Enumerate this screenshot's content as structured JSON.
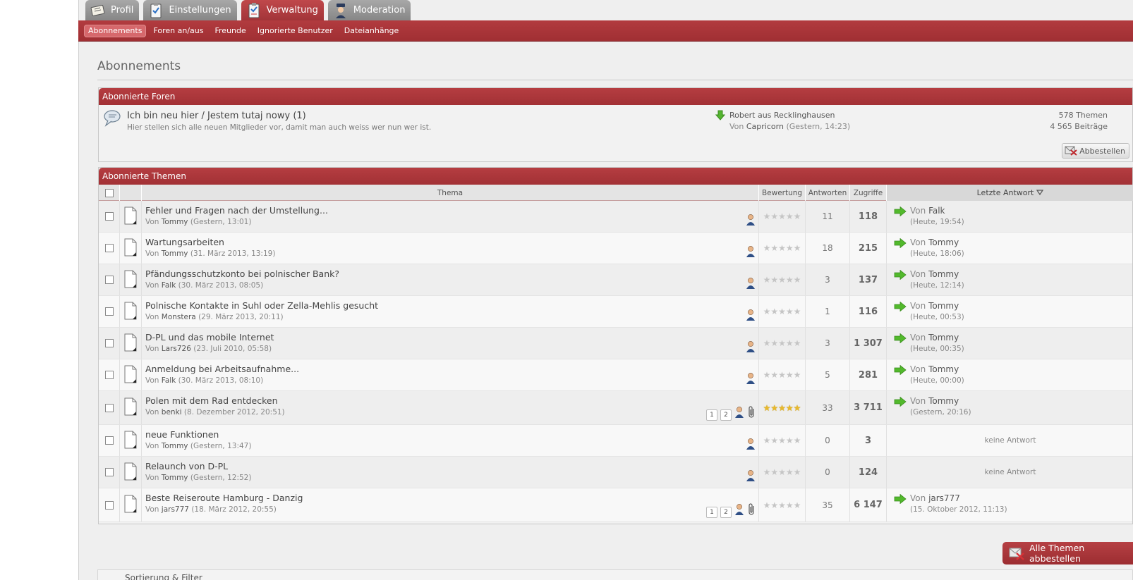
{
  "tabs": [
    {
      "label": "Profil",
      "icon": "profile-card-icon",
      "active": false
    },
    {
      "label": "Einstellungen",
      "icon": "settings-clipboard-icon",
      "active": false
    },
    {
      "label": "Verwaltung",
      "icon": "management-clipboard-icon",
      "active": true
    },
    {
      "label": "Moderation",
      "icon": "moderator-officer-icon",
      "active": false
    }
  ],
  "subnav": [
    {
      "label": "Abonnements",
      "active": true
    },
    {
      "label": "Foren an/aus",
      "active": false
    },
    {
      "label": "Freunde",
      "active": false
    },
    {
      "label": "Ignorierte Benutzer",
      "active": false
    },
    {
      "label": "Dateianhänge",
      "active": false
    }
  ],
  "page_title": "Abonnements",
  "forums_box": {
    "heading": "Abonnierte Foren",
    "forum": {
      "title": "Ich bin neu hier / Jestem tutaj nowy (1)",
      "description": "Hier stellen sich alle neuen Mitglieder vor, damit man auch weiss wer nun wer ist.",
      "last_post_title": "Robert aus Recklinghausen",
      "last_post_by_prefix": "Von",
      "last_post_author": "Capricorn",
      "last_post_time": "(Gestern, 14:23)",
      "threads": "578 Themen",
      "posts": "4 565 Beiträge"
    },
    "unsubscribe_label": "Abbestellen"
  },
  "topics_box": {
    "heading": "Abonnierte Themen",
    "columns": {
      "topic": "Thema",
      "rating": "Bewertung",
      "replies": "Antworten",
      "views": "Zugriffe",
      "last_reply": "Letzte Antwort"
    },
    "rows": [
      {
        "title": "Fehler und Fragen nach der Umstellung...",
        "by": "Von",
        "author": "Tommy",
        "date": "(Gestern, 13:01)",
        "pages": [],
        "attachment": false,
        "rating": 0,
        "replies": "11",
        "views": "118",
        "last_by": "Von",
        "last_author": "Falk",
        "last_time": "(Heute, 19:54)"
      },
      {
        "title": "Wartungsarbeiten",
        "by": "Von",
        "author": "Tommy",
        "date": "(31. März 2013, 13:19)",
        "pages": [],
        "attachment": false,
        "rating": 0,
        "replies": "18",
        "views": "215",
        "last_by": "Von",
        "last_author": "Tommy",
        "last_time": "(Heute, 18:06)"
      },
      {
        "title": "Pfändungsschutzkonto bei polnischer Bank?",
        "by": "Von",
        "author": "Falk",
        "date": "(30. März 2013, 08:05)",
        "pages": [],
        "attachment": false,
        "rating": 0,
        "replies": "3",
        "views": "137",
        "last_by": "Von",
        "last_author": "Tommy",
        "last_time": "(Heute, 12:14)"
      },
      {
        "title": "Polnische Kontakte in Suhl oder Zella-Mehlis gesucht",
        "by": "Von",
        "author": "Monstera",
        "date": "(29. März 2013, 20:11)",
        "pages": [],
        "attachment": false,
        "rating": 0,
        "replies": "1",
        "views": "116",
        "last_by": "Von",
        "last_author": "Tommy",
        "last_time": "(Heute, 00:53)"
      },
      {
        "title": "D-PL und das mobile Internet",
        "by": "Von",
        "author": "Lars726",
        "date": "(23. Juli 2010, 05:58)",
        "pages": [],
        "attachment": false,
        "rating": 0,
        "replies": "3",
        "views": "1 307",
        "last_by": "Von",
        "last_author": "Tommy",
        "last_time": "(Heute, 00:35)"
      },
      {
        "title": "Anmeldung bei Arbeitsaufnahme...",
        "by": "Von",
        "author": "Falk",
        "date": "(30. März 2013, 08:10)",
        "pages": [],
        "attachment": false,
        "rating": 0,
        "replies": "5",
        "views": "281",
        "last_by": "Von",
        "last_author": "Tommy",
        "last_time": "(Heute, 00:00)"
      },
      {
        "title": "Polen mit dem Rad entdecken",
        "by": "Von",
        "author": "benki",
        "date": "(8. Dezember 2012, 20:51)",
        "pages": [
          "1",
          "2"
        ],
        "attachment": true,
        "rating": 5,
        "replies": "33",
        "views": "3 711",
        "last_by": "Von",
        "last_author": "Tommy",
        "last_time": "(Gestern, 20:16)"
      },
      {
        "title": "neue Funktionen",
        "by": "Von",
        "author": "Tommy",
        "date": "(Gestern, 13:47)",
        "pages": [],
        "attachment": false,
        "rating": 0,
        "replies": "0",
        "views": "3",
        "no_reply": "keine Antwort"
      },
      {
        "title": "Relaunch von D-PL",
        "by": "Von",
        "author": "Tommy",
        "date": "(Gestern, 12:52)",
        "pages": [],
        "attachment": false,
        "rating": 0,
        "replies": "0",
        "views": "124",
        "no_reply": "keine Antwort"
      },
      {
        "title": "Beste Reiseroute Hamburg - Danzig",
        "by": "Von",
        "author": "jars777",
        "date": "(18. März 2012, 20:55)",
        "pages": [
          "1",
          "2"
        ],
        "attachment": true,
        "rating": 0,
        "replies": "35",
        "views": "6 147",
        "last_by": "Von",
        "last_author": "jars777",
        "last_time": "(15. Oktober 2012, 11:13)"
      }
    ]
  },
  "unsubscribe_all_label": "Alle Themen abbestellen",
  "bottom_box_label": "Sortierung & Filter",
  "colors": {
    "accent": "#a83236",
    "star_on": "#e9b92a",
    "arrow_green": "#4cb82c"
  }
}
